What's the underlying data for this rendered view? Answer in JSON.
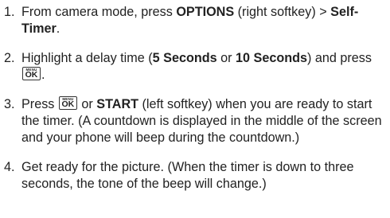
{
  "steps": [
    {
      "number": "1.",
      "parts": [
        "From camera mode, press ",
        "OPTIONS",
        " (right softkey) > ",
        "Self-Timer",
        "."
      ]
    },
    {
      "number": "2.",
      "parts": [
        "Highlight a delay time (",
        "5 Seconds",
        " or ",
        "10 Seconds",
        ") and press ",
        "."
      ]
    },
    {
      "number": "3.",
      "parts": [
        "Press ",
        " or ",
        "START",
        " (left softkey) when you are ready to start the timer. (A countdown is displayed in the middle of the screen and your phone will beep during the countdown.)"
      ]
    },
    {
      "number": "4.",
      "parts": [
        "Get ready for the picture. (When the timer is down to three seconds, the tone of the beep will change.)"
      ]
    }
  ],
  "key": {
    "small": "MENU",
    "big": "OK",
    "icon": "menu-ok-key-icon"
  }
}
